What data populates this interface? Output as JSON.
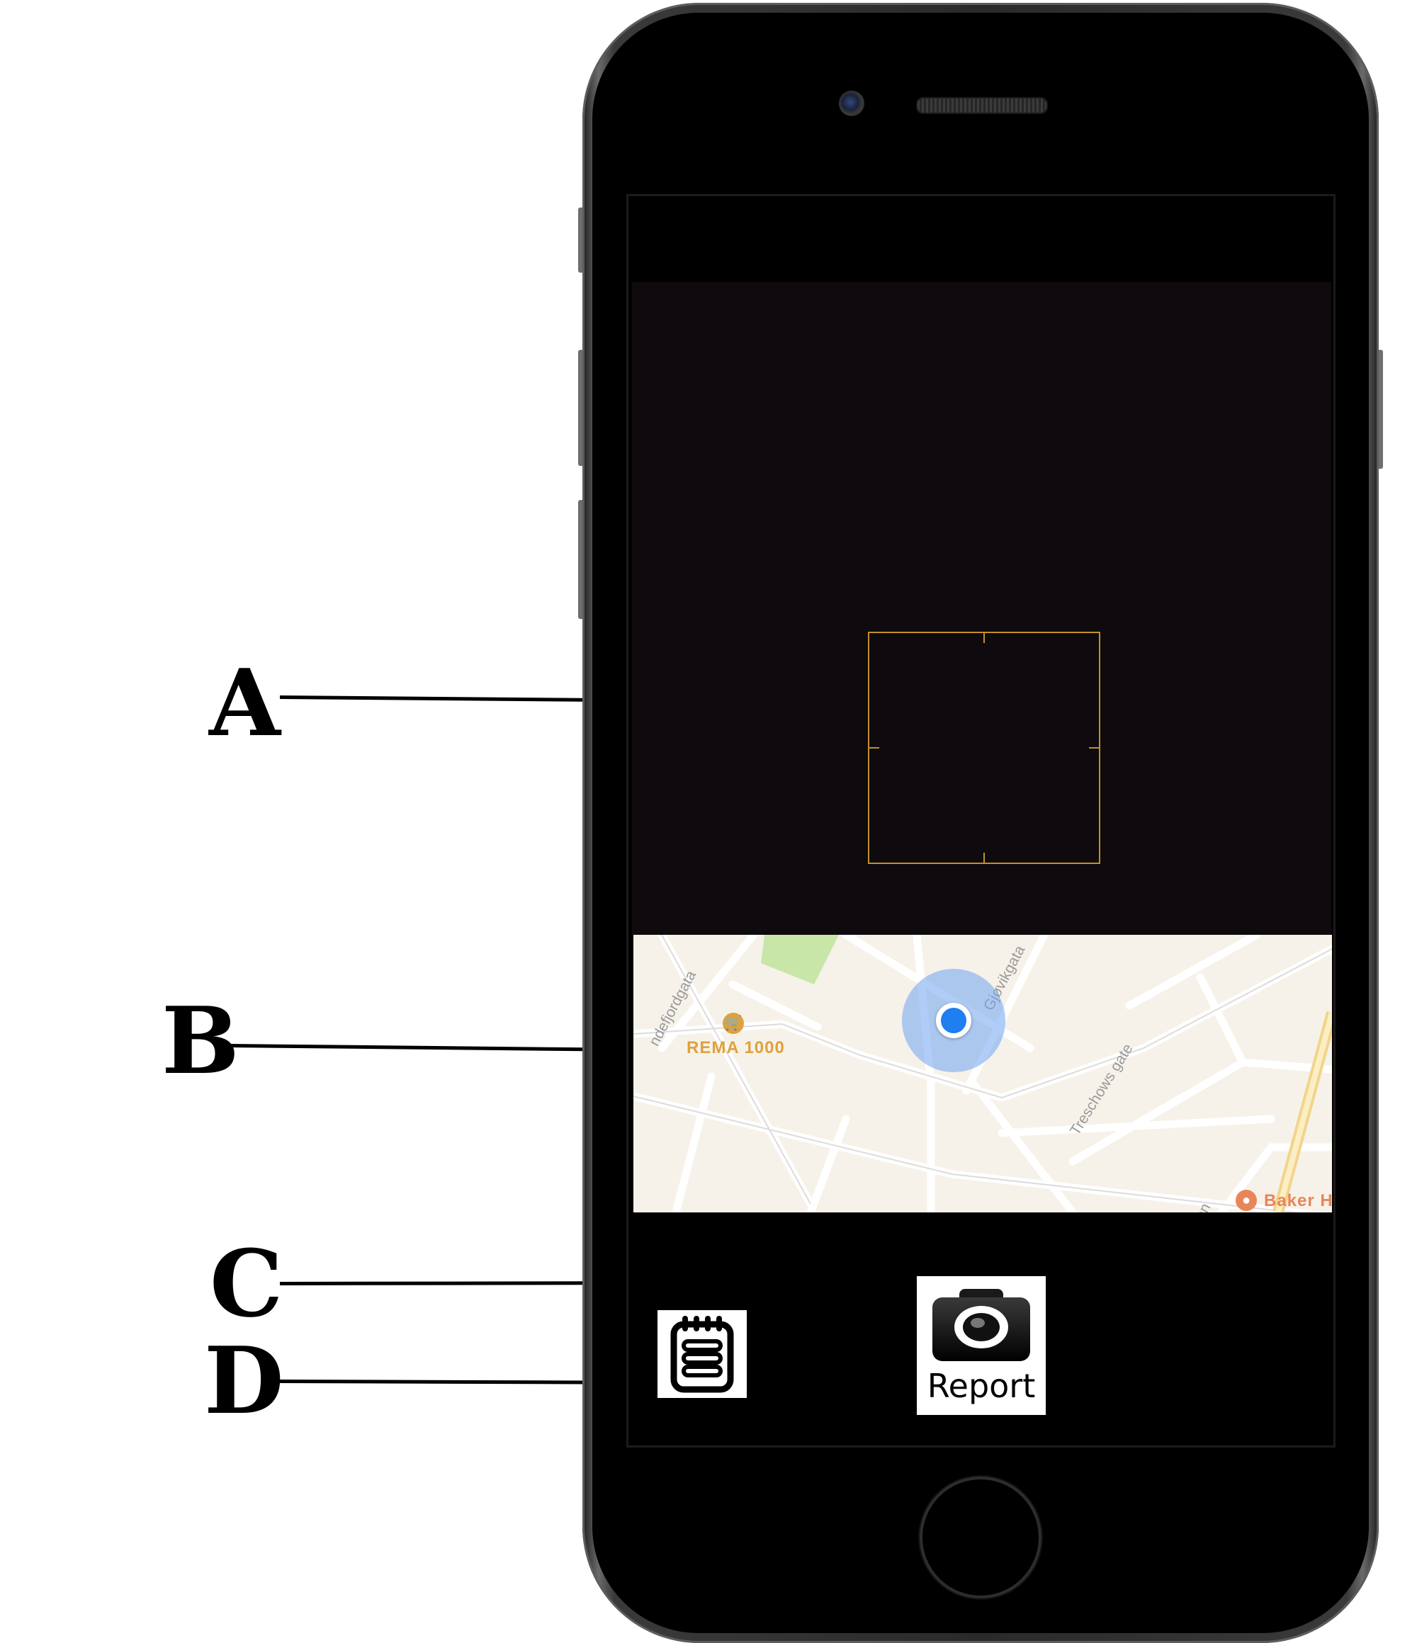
{
  "callouts": [
    {
      "letter": "A",
      "target": "camera-preview"
    },
    {
      "letter": "B",
      "target": "map-view"
    },
    {
      "letter": "C",
      "target": "report-button"
    },
    {
      "letter": "D",
      "target": "notes-button"
    }
  ],
  "map": {
    "poi_store": "REMA 1000",
    "poi_bakery": "Baker H",
    "street_1": "Gjøvikgata",
    "street_2": "Treschows gate",
    "street_3": "ndefjordgata",
    "street_4": "ien"
  },
  "controls": {
    "report_label": "Report"
  },
  "icons": {
    "report": "camera-icon",
    "notes": "notepad-icon",
    "store_poi": "shopping-cart-icon",
    "bakery_poi": "bakery-icon"
  },
  "colors": {
    "focus_box": "#c1902a",
    "location_dot": "#1f7ef0",
    "map_background": "#f6f2ea",
    "poi_store": "#e0a13c"
  }
}
